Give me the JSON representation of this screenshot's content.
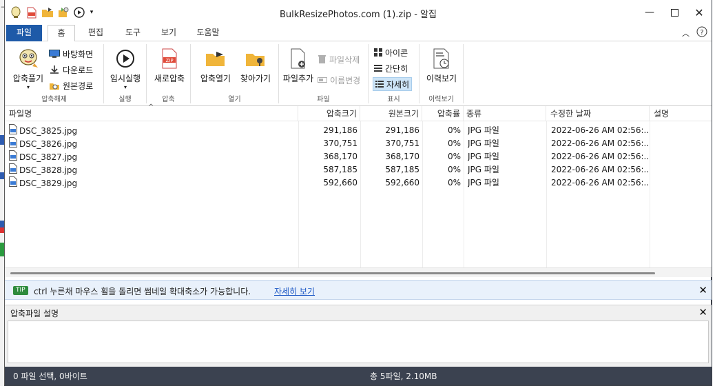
{
  "window": {
    "title": "BulkResizePhotos.com (1).zip - 알집"
  },
  "tabs": {
    "file": "파일",
    "home": "홈",
    "edit": "편집",
    "tools": "도구",
    "view": "보기",
    "help": "도움말"
  },
  "ribbon": {
    "extract": {
      "big": "압축풀기",
      "desktop": "바탕화면",
      "downloads": "다운로드",
      "original": "원본경로",
      "group": "압축해제"
    },
    "run": {
      "big": "임시실행",
      "group": "실행"
    },
    "compress": {
      "big": "새로압축",
      "group": "압축"
    },
    "open": {
      "open_archive": "압축열기",
      "browse": "찾아가기",
      "group": "열기"
    },
    "file": {
      "add": "파일추가",
      "delete": "파일삭제",
      "rename": "이름변경",
      "group": "파일"
    },
    "display": {
      "icons": "아이콘",
      "simple": "간단히",
      "details": "자세히",
      "group": "표시"
    },
    "history": {
      "big": "이력보기",
      "group": "이력보기"
    }
  },
  "list": {
    "columns": {
      "name": "파일명",
      "compressed": "압축크기",
      "original": "원본크기",
      "ratio": "압축률",
      "type": "종류",
      "modified": "수정한 날짜",
      "desc": "설명"
    },
    "rows": [
      {
        "name": "DSC_3825.jpg",
        "compressed": "291,186",
        "original": "291,186",
        "ratio": "0%",
        "type": "JPG 파일",
        "modified": "2022-06-26 AM 02:56:..."
      },
      {
        "name": "DSC_3826.jpg",
        "compressed": "370,751",
        "original": "370,751",
        "ratio": "0%",
        "type": "JPG 파일",
        "modified": "2022-06-26 AM 02:56:..."
      },
      {
        "name": "DSC_3827.jpg",
        "compressed": "368,170",
        "original": "368,170",
        "ratio": "0%",
        "type": "JPG 파일",
        "modified": "2022-06-26 AM 02:56:..."
      },
      {
        "name": "DSC_3828.jpg",
        "compressed": "587,185",
        "original": "587,185",
        "ratio": "0%",
        "type": "JPG 파일",
        "modified": "2022-06-26 AM 02:56:..."
      },
      {
        "name": "DSC_3829.jpg",
        "compressed": "592,660",
        "original": "592,660",
        "ratio": "0%",
        "type": "JPG 파일",
        "modified": "2022-06-26 AM 02:56:..."
      }
    ]
  },
  "tip": {
    "badge": "TIP",
    "text": "ctrl 누른채 마우스 휠을 돌리면 썸네일 확대축소가 가능합니다.",
    "link": "자세히 보기"
  },
  "description_panel": {
    "title": "압축파일 설명"
  },
  "status": {
    "left": "0 파일 선택,  0바이트",
    "center": "총 5파일,  2.10MB"
  },
  "colors": {
    "file_tab": "#1e5aa8",
    "status_bar": "#3b4250",
    "tip_badge": "#2e8b3d",
    "link": "#1a56c4",
    "selected": "#cce4f7"
  }
}
